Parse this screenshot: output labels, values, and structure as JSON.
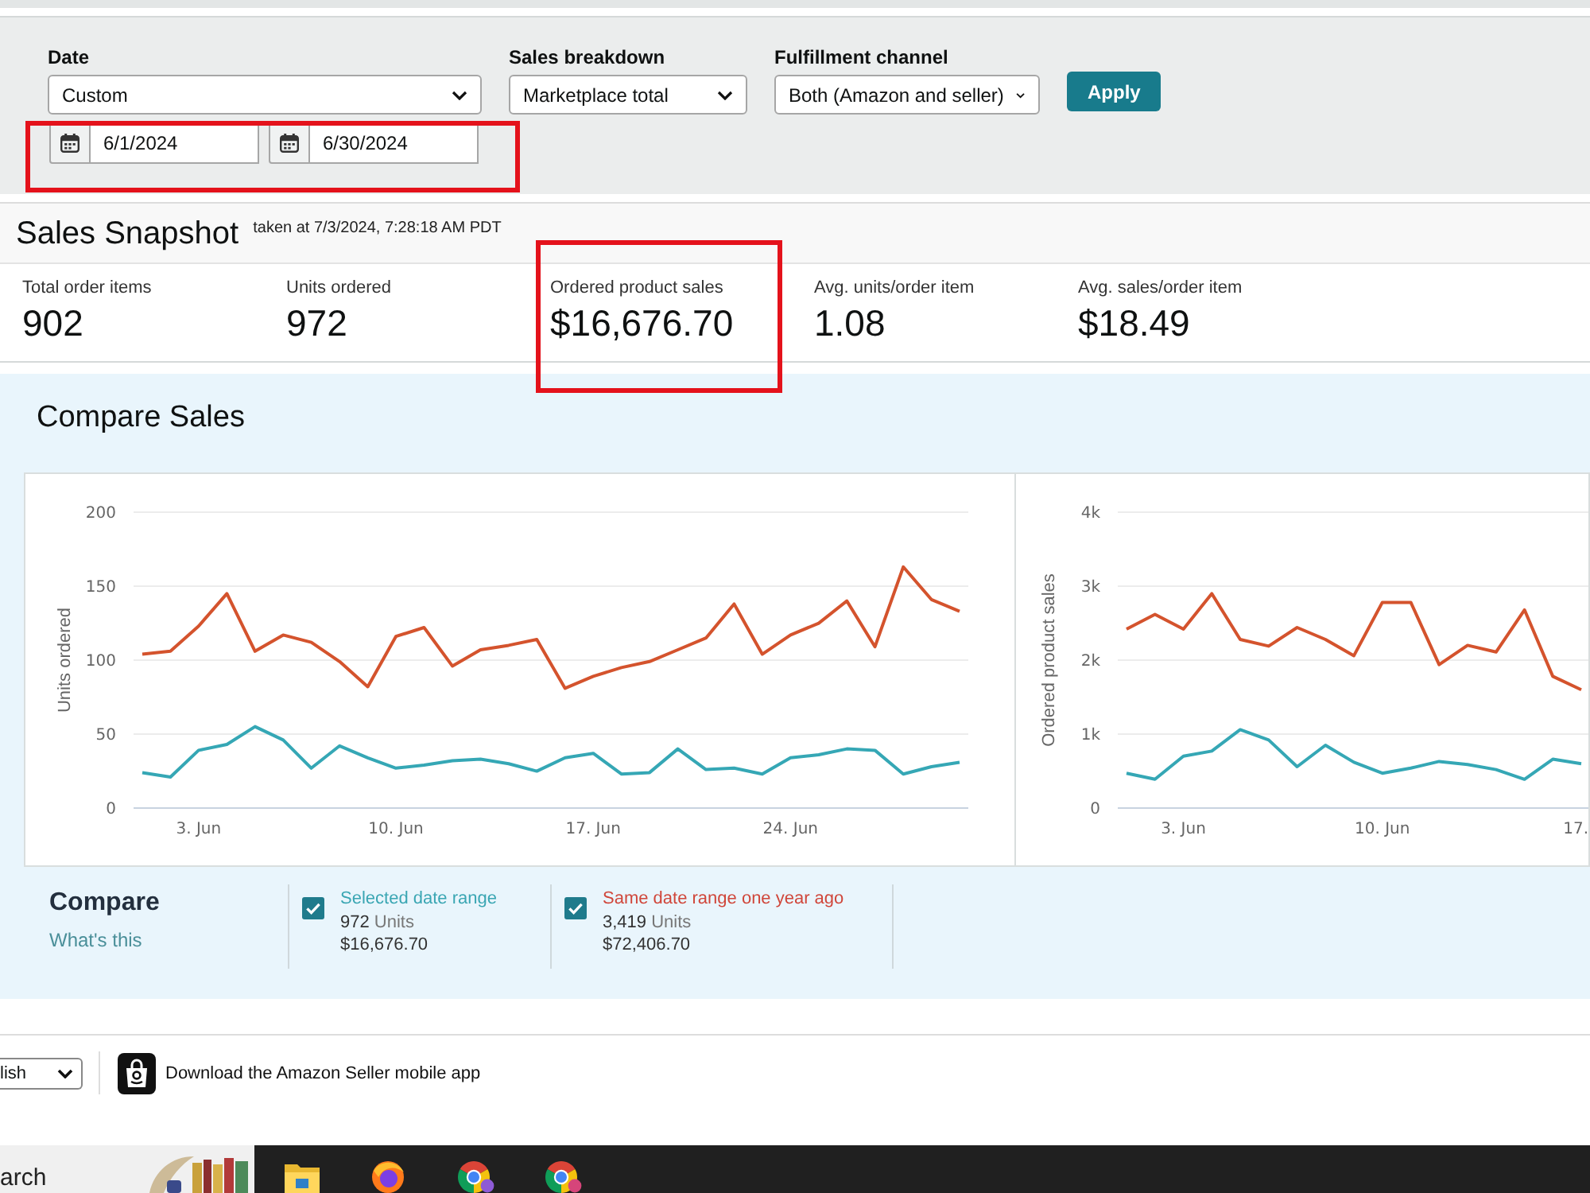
{
  "filters": {
    "fields": [
      {
        "label": "Date",
        "value": "Custom"
      },
      {
        "label": "Sales breakdown",
        "value": "Marketplace total"
      },
      {
        "label": "Fulfillment channel",
        "value": "Both (Amazon and seller)"
      }
    ],
    "apply_button": "Apply",
    "date_range": {
      "highlighted": true,
      "start": "6/1/2024",
      "end": "6/30/2024"
    }
  },
  "snapshot": {
    "title": "Sales Snapshot",
    "taken_at": "taken at 7/3/2024, 7:28:18 AM PDT",
    "metrics": [
      {
        "label": "Total order items",
        "value": "902",
        "highlighted": false
      },
      {
        "label": "Units ordered",
        "value": "972",
        "highlighted": false
      },
      {
        "label": "Ordered product sales",
        "value": "$16,676.70",
        "highlighted": true
      },
      {
        "label": "Avg. units/order item",
        "value": "1.08",
        "highlighted": false
      },
      {
        "label": "Avg. sales/order item",
        "value": "$18.49",
        "highlighted": false
      }
    ]
  },
  "compare_sales": {
    "title": "Compare Sales",
    "charts": [
      {
        "chart_data": {
          "type": "line",
          "ylabel": "Units ordered",
          "categories": [
            null,
            null,
            "3. Jun",
            null,
            null,
            null,
            null,
            null,
            null,
            "10. Jun",
            null,
            null,
            null,
            null,
            null,
            null,
            "17. Jun",
            null,
            null,
            null,
            null,
            null,
            null,
            "24. Jun",
            null,
            null,
            null,
            null,
            null,
            null
          ],
          "ylim": [
            0,
            200
          ],
          "yticks": [
            0,
            50,
            100,
            150,
            200
          ],
          "grid": true,
          "series": [
            {
              "color": "#35a7b5",
              "values": [
                24,
                21,
                39,
                43,
                55,
                46,
                27,
                42,
                34,
                27,
                29,
                32,
                33,
                30,
                25,
                34,
                37,
                23,
                24,
                40,
                26,
                27,
                23,
                34,
                36,
                40,
                39,
                23,
                28,
                31
              ]
            },
            {
              "color": "#d4532d",
              "values": [
                104,
                106,
                123,
                145,
                106,
                117,
                112,
                99,
                82,
                116,
                122,
                96,
                107,
                110,
                114,
                81,
                89,
                95,
                99,
                107,
                115,
                138,
                104,
                117,
                125,
                140,
                109,
                163,
                141,
                133
              ]
            }
          ]
        }
      },
      {
        "chart_data": {
          "type": "line",
          "ylabel": "Ordered product sales",
          "categories": [
            null,
            null,
            "3. Jun",
            null,
            null,
            null,
            null,
            null,
            null,
            "10. Jun",
            null,
            null,
            null,
            null,
            null,
            null,
            "17."
          ],
          "ylim": [
            0,
            4000
          ],
          "yticks": [
            0,
            {
              "value": 1000,
              "label": "1k"
            },
            {
              "value": 2000,
              "label": "2k"
            },
            {
              "value": 3000,
              "label": "3k"
            },
            {
              "value": 4000,
              "label": "4k"
            }
          ],
          "grid": true,
          "series": [
            {
              "color": "#35a7b5",
              "values": [
                470,
                390,
                700,
                770,
                1060,
                920,
                560,
                850,
                620,
                470,
                540,
                630,
                590,
                520,
                390,
                660,
                600
              ]
            },
            {
              "color": "#d4532d",
              "values": [
                2420,
                2620,
                2420,
                2900,
                2280,
                2190,
                2440,
                2280,
                2060,
                2780,
                2780,
                1940,
                2200,
                2110,
                2680,
                1780,
                1600
              ]
            }
          ]
        }
      }
    ],
    "legend": {
      "title": "Compare",
      "link": "What's this",
      "items": [
        {
          "checked": true,
          "label": "Selected date range",
          "color": "#3aa6b3",
          "units": "972",
          "units_label": "Units",
          "sales": "$16,676.70"
        },
        {
          "checked": true,
          "label": "Same date range one year ago",
          "color": "#d0463a",
          "units": "3,419",
          "units_label": "Units",
          "sales": "$72,406.70"
        }
      ]
    }
  },
  "footer": {
    "language": "lish",
    "app_link": "Download the Amazon Seller mobile app"
  },
  "taskbar": {
    "search": {
      "placeholder": "arch"
    }
  }
}
